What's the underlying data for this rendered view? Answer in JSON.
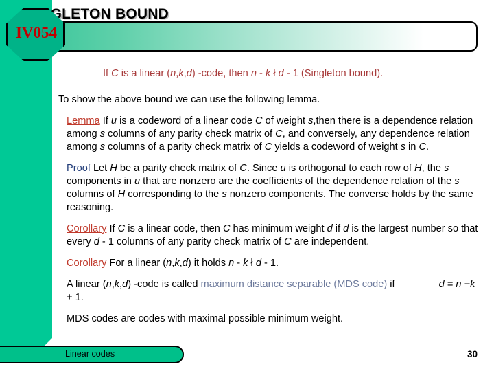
{
  "slide": {
    "badge_label": "IV054",
    "title": "SINGLETON BOUND",
    "page_number": "30",
    "footer_label": "Linear codes",
    "colors": {
      "stripe_green": "#00c996",
      "badge_green": "#00b388",
      "badge_text_red": "#c00000",
      "lead_line_red": "#a83b3b",
      "keyword_red": "#c0392b",
      "keyword_blue": "#243f7a",
      "mds_blue": "#6d7a9c",
      "title_gradient_from": "#3cc79b",
      "title_gradient_to": "#ffffff"
    }
  },
  "content": {
    "lead_line": {
      "p1": "If ",
      "c1": "C",
      "p2": " is a linear (",
      "n1": "n",
      "comma1": ",",
      "k1": "k",
      "comma2": ",",
      "d1": "d",
      "p3": ") -code, then ",
      "n2": "n",
      "p4": " - ",
      "k2": "k",
      "p5": " ł  ",
      "d2": "d",
      "p6": " - 1 (Singleton bound)."
    },
    "intro": "To show the above bound we can use the following lemma.",
    "lemma": {
      "keyword": "Lemma",
      "t1": " If ",
      "u1": "u",
      "t2": " is a codeword  of a linear code ",
      "c1": "C",
      "t3": " of weight ",
      "s1": "s",
      "t4": ",then there is a dependence relation among ",
      "s2": "s",
      "t5": " columns of any parity check matrix of ",
      "c2": "C",
      "t6": ", and conversely, any dependence relation among ",
      "s3": "s",
      "t7": " columns of a parity check matrix of ",
      "c3": "C",
      "t8": " yields a codeword of weight ",
      "s4": "s",
      "t9": " in ",
      "c4": "C",
      "t10": "."
    },
    "proof": {
      "keyword": "Proof",
      "t1": " Let ",
      "h1": "H",
      "t2": " be a parity check matrix of ",
      "c1": "C",
      "t3": ". Since ",
      "u1": "u",
      "t4": " is orthogonal to each row of ",
      "h2": "H",
      "t5": ", the ",
      "s1": "s",
      "t6": " components in ",
      "u2": "u",
      "t7": " that are nonzero are the coefficients of  the dependence relation of the ",
      "s2": "s",
      "t8": " columns of ",
      "h3": "H",
      "t9": " corresponding to the ",
      "s3": "s",
      "t10": " nonzero components. The converse holds by the same reasoning."
    },
    "corollary1": {
      "keyword": "Corollary",
      "t1": " If ",
      "c1": "C",
      "t2": " is a linear code, then ",
      "c2": "C",
      "t3": " has minimum weight ",
      "d1": "d",
      "t4": " if ",
      "d2": "d",
      "t5": " is the largest number so that every ",
      "d3": "d",
      "t6": " - 1 columns of any parity check matrix  of ",
      "c3": "C",
      "t7": " are independent."
    },
    "corollary2": {
      "keyword": "Corollary",
      "t1": " For a linear (",
      "n1": "n",
      "comma1": ",",
      "k1": "k",
      "comma2": ",",
      "d1": "d",
      "t2": ") it holds ",
      "n2": "n",
      "t3": " - ",
      "k2": "k",
      "t4": " ł  ",
      "d2": "d",
      "t5": " - 1."
    },
    "mds_def": {
      "t1": "A linear (",
      "n1": "n",
      "comma1": ",",
      "k1": "k",
      "comma2": ",",
      "d1": "d",
      "t2": ") -code is called ",
      "mds": "maximum distance separable (MDS code)",
      "t3": " if ",
      "d2": "d",
      "t4": " = ",
      "n2": "n",
      "t5": " −",
      "k2": "k",
      "t6": " + 1."
    },
    "closing": "MDS codes are codes with maximal possible minimum weight."
  }
}
